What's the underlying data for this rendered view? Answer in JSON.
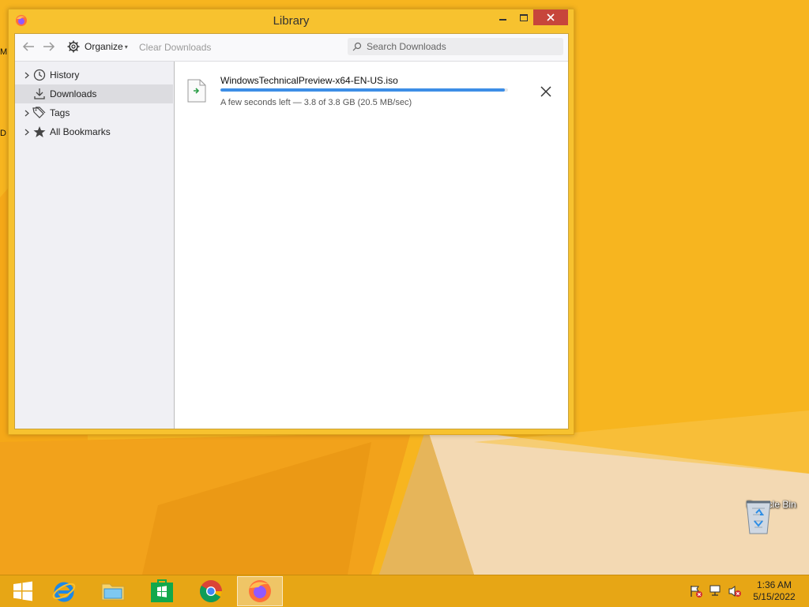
{
  "window": {
    "title": "Library"
  },
  "toolbar": {
    "organize_label": "Organize",
    "clear_label": "Clear Downloads",
    "search_placeholder": "Search Downloads"
  },
  "sidebar": {
    "items": [
      {
        "label": "History",
        "icon": "clock-icon"
      },
      {
        "label": "Downloads",
        "icon": "download-icon"
      },
      {
        "label": "Tags",
        "icon": "tags-icon"
      },
      {
        "label": "All Bookmarks",
        "icon": "star-icon"
      }
    ]
  },
  "downloads": [
    {
      "filename": "WindowsTechnicalPreview-x64-EN-US.iso",
      "status": "A few seconds left — 3.8 of 3.8 GB (20.5 MB/sec)",
      "progress_percent": 99
    }
  ],
  "desktop": {
    "recycle_bin_label": "Recycle Bin",
    "edge_letters": [
      "M",
      "D"
    ]
  },
  "taskbar": {
    "apps": [
      "start-button",
      "internet-explorer",
      "file-explorer",
      "windows-store",
      "chrome",
      "firefox"
    ],
    "time": "1:36 AM",
    "date": "5/15/2022"
  },
  "colors": {
    "desktop_orange": "#f6b21e",
    "window_frame": "#f7c22f",
    "close_red": "#c7453b",
    "progress_blue": "#3d8ee6",
    "taskbar": "#e7a615"
  }
}
